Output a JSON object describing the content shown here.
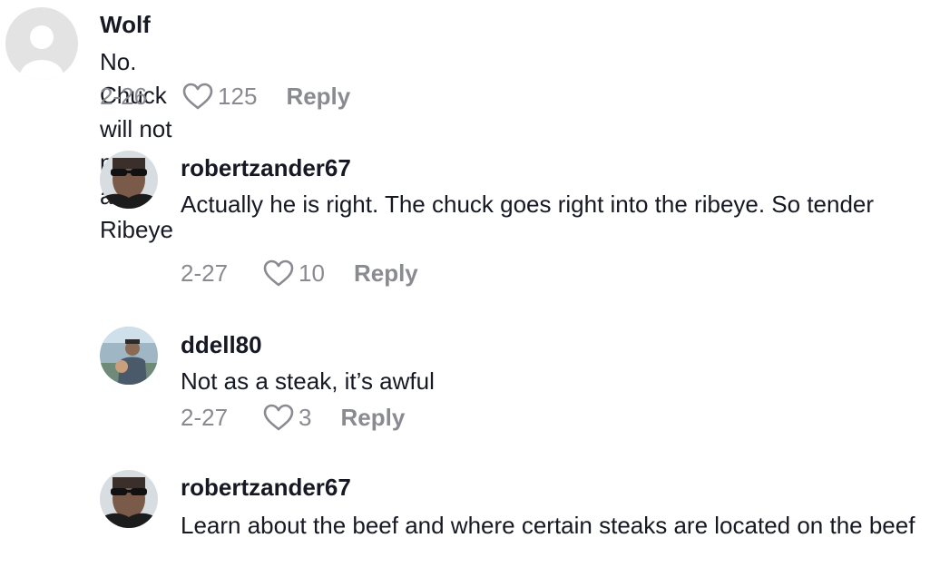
{
  "comments": [
    {
      "username": "Wolf",
      "text": "No. Chuck will not pass as Ribeye",
      "date": "2-26",
      "likes": "125",
      "reply_label": "Reply",
      "avatar_icon": "default-avatar-icon"
    },
    {
      "username": "robertzander67",
      "text": "Actually he is right. The chuck goes right into the ribeye. So tender",
      "date": "2-27",
      "likes": "10",
      "reply_label": "Reply",
      "avatar_icon": "user-photo-avatar"
    },
    {
      "username": "ddell80",
      "text": "Not as a steak, it’s awful",
      "date": "2-27",
      "likes": "3",
      "reply_label": "Reply",
      "avatar_icon": "user-photo-avatar"
    },
    {
      "username": "robertzander67",
      "text": "Learn about the beef and where certain steaks are located on the beef",
      "avatar_icon": "user-photo-avatar"
    }
  ],
  "colors": {
    "text_primary": "#161823",
    "text_secondary": "#8a8b91",
    "background": "#ffffff"
  }
}
